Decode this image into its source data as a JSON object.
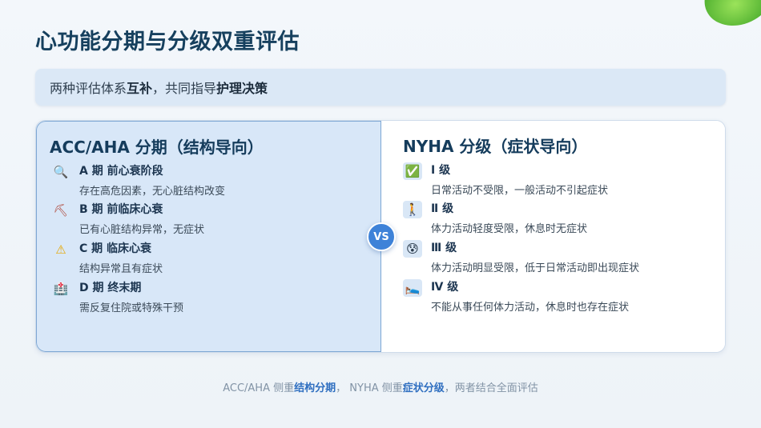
{
  "title": "心功能分期与分级双重评估",
  "subtitle": {
    "pre": "两种评估体系",
    "bold1": "互补",
    "mid": "，共同指导",
    "bold2": "护理决策"
  },
  "left_card": {
    "title": "ACC/AHA 分期（结构导向）",
    "items": [
      {
        "icon": "magnifier-icon",
        "glyph": "🔍",
        "label": "A 期 前心衰阶段",
        "desc": "存在高危因素，无心脏结构改变"
      },
      {
        "icon": "oil-pump-icon",
        "glyph": "⛏",
        "label": "B 期 前临床心衰",
        "desc": "已有心脏结构异常，无症状"
      },
      {
        "icon": "warning-icon",
        "glyph": "⚠",
        "label": "C 期 临床心衰",
        "desc": "结构异常且有症状"
      },
      {
        "icon": "hospital-icon",
        "glyph": "🏥",
        "label": "D 期 终末期",
        "desc": "需反复住院或特殊干预"
      }
    ]
  },
  "vs_label": "VS",
  "right_card": {
    "title": "NYHA 分级（症状导向）",
    "items": [
      {
        "icon": "check-box-icon",
        "glyph": "✅",
        "label": "Ⅰ 级",
        "desc": "日常活动不受限，一般活动不引起症状"
      },
      {
        "icon": "walking-person-icon",
        "glyph": "🚶",
        "label": "Ⅱ 级",
        "desc": "体力活动轻度受限，休息时无症状"
      },
      {
        "icon": "worried-face-icon",
        "glyph": "😰",
        "label": "Ⅲ 级",
        "desc": "体力活动明显受限，低于日常活动即出现症状"
      },
      {
        "icon": "bed-icon",
        "glyph": "🛌",
        "label": "Ⅳ 级",
        "desc": "不能从事任何体力活动，休息时也存在症状"
      }
    ]
  },
  "footer": {
    "p1": "ACC/AHA 侧重",
    "b1": "结构分期",
    "p2": "， NYHA 侧重",
    "b2": "症状分级",
    "p3": "，两者结合全面评估"
  },
  "colors": {
    "title": "#16405e",
    "accent": "#3e82d8",
    "left_card_bg": "#d8e7f8",
    "left_card_border": "#7ea7d4"
  }
}
